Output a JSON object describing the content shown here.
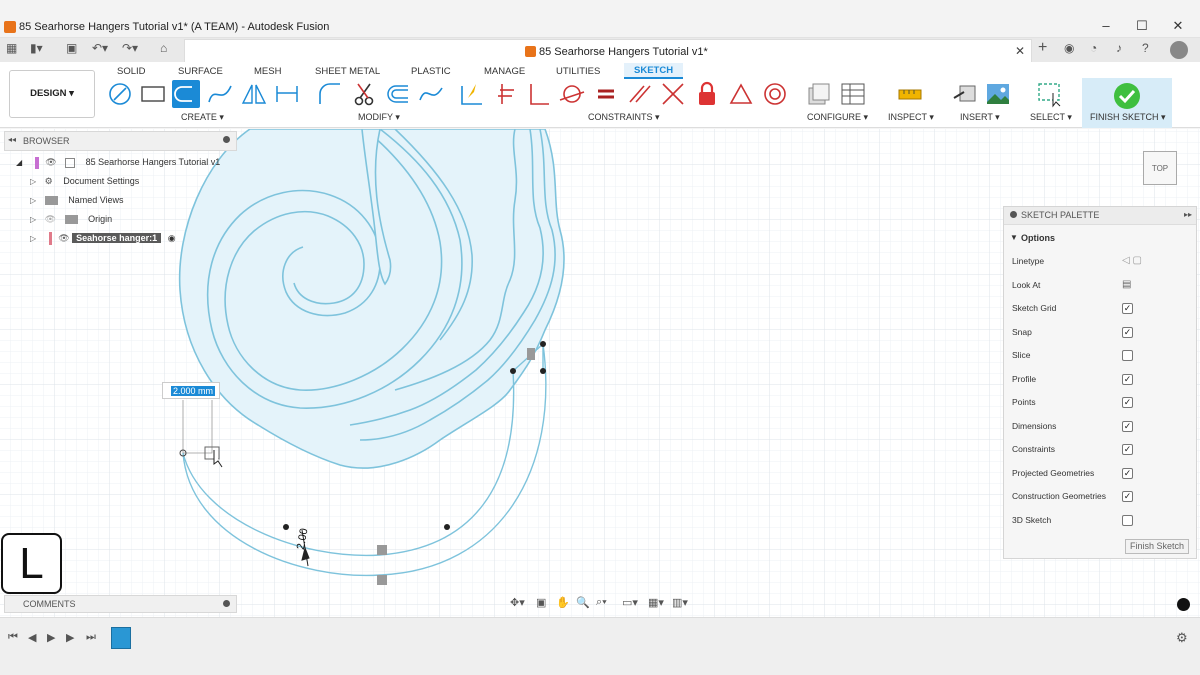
{
  "window": {
    "title": "85 Searhorse Hangers Tutorial v1* (A TEAM) - Autodesk Fusion",
    "controls": [
      "–",
      "☐",
      "✕"
    ]
  },
  "document_tab": {
    "label": "85 Searhorse Hangers Tutorial v1*"
  },
  "design_button": "DESIGN ▾",
  "tabs": [
    "SOLID",
    "SURFACE",
    "MESH",
    "SHEET METAL",
    "PLASTIC",
    "MANAGE",
    "UTILITIES",
    "SKETCH"
  ],
  "active_tab": "SKETCH",
  "groups": {
    "create": "CREATE ▾",
    "modify": "MODIFY ▾",
    "constraints": "CONSTRAINTS ▾",
    "configure": "CONFIGURE ▾",
    "inspect": "INSPECT ▾",
    "insert": "INSERT ▾",
    "select": "SELECT ▾",
    "finish": "FINISH SKETCH ▾"
  },
  "browser": {
    "header": "BROWSER",
    "items": [
      {
        "label": "85 Searhorse Hangers Tutorial v1"
      },
      {
        "label": "Document Settings"
      },
      {
        "label": "Named Views"
      },
      {
        "label": "Origin"
      },
      {
        "label": "Seahorse hanger:1"
      }
    ]
  },
  "comments": "COMMENTS",
  "dimension_input": "2.000 mm",
  "dimension_label": "2.00",
  "viewcube": "TOP",
  "shortcut_key": "L",
  "palette": {
    "header": "SKETCH PALETTE",
    "section": "Options",
    "rows": [
      {
        "label": "Linetype",
        "type": "icons"
      },
      {
        "label": "Look At",
        "type": "icon"
      },
      {
        "label": "Sketch Grid",
        "checked": true
      },
      {
        "label": "Snap",
        "checked": true
      },
      {
        "label": "Slice",
        "checked": false
      },
      {
        "label": "Profile",
        "checked": true
      },
      {
        "label": "Points",
        "checked": true
      },
      {
        "label": "Dimensions",
        "checked": true
      },
      {
        "label": "Constraints",
        "checked": true
      },
      {
        "label": "Projected Geometries",
        "checked": true
      },
      {
        "label": "Construction Geometries",
        "checked": true
      },
      {
        "label": "3D Sketch",
        "checked": false
      }
    ],
    "finish_button": "Finish Sketch"
  },
  "colors": {
    "accent": "#1b8ad6",
    "sketch": "#7ec3dc",
    "profile_fill": "#e4f3fa",
    "finish": "#3fbf3f"
  }
}
